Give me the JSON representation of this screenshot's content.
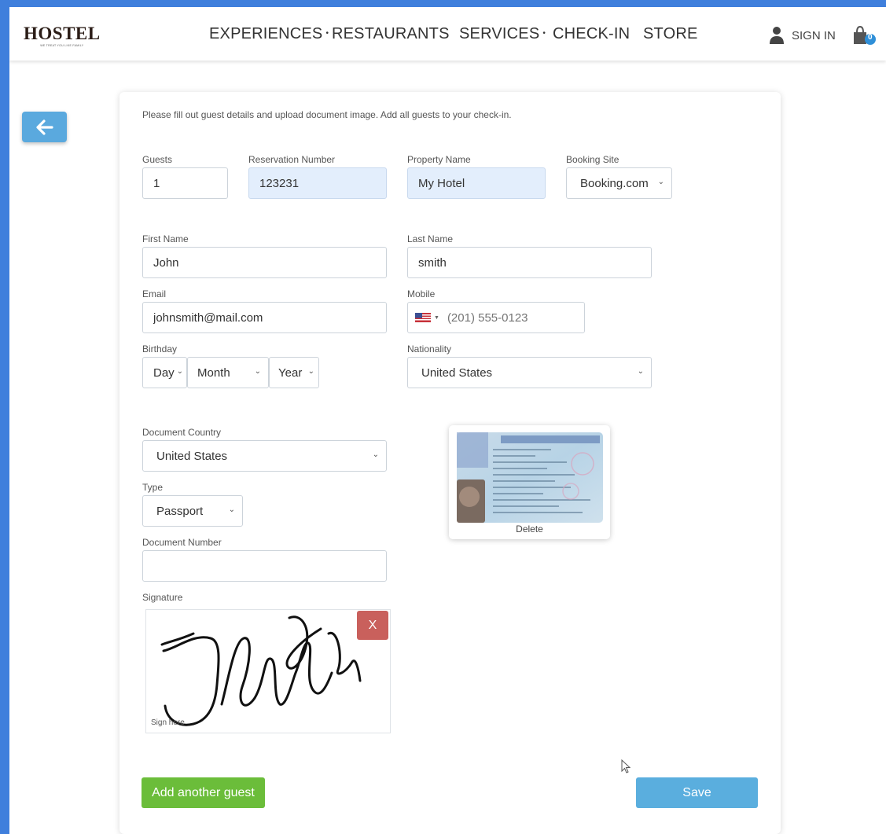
{
  "header": {
    "logo": "HOSTEL",
    "logo_tagline": "WE TREAT YOU LIKE FAMILY",
    "nav": [
      {
        "label": "EXPERIENCES",
        "has_caret": true
      },
      {
        "label": "RESTAURANTS",
        "has_caret": false
      },
      {
        "label": "SERVICES",
        "has_caret": true
      },
      {
        "label": "CHECK-IN",
        "has_caret": false
      },
      {
        "label": "STORE",
        "has_caret": false
      }
    ],
    "sign_in": "SIGN IN",
    "cart_count": "0"
  },
  "form": {
    "intro": "Please fill out guest details and upload document image. Add all guests to your check-in.",
    "guests": {
      "label": "Guests",
      "value": "1"
    },
    "reservation": {
      "label": "Reservation Number",
      "value": "123231"
    },
    "property": {
      "label": "Property Name",
      "value": "My Hotel"
    },
    "booking_site": {
      "label": "Booking Site",
      "value": "Booking.com"
    },
    "first_name": {
      "label": "First Name",
      "value": "John"
    },
    "last_name": {
      "label": "Last Name",
      "value": "smith"
    },
    "email": {
      "label": "Email",
      "value": "johnsmith@mail.com"
    },
    "mobile": {
      "label": "Mobile",
      "placeholder": "(201) 555-0123",
      "flag": "us-flag-icon"
    },
    "birthday": {
      "label": "Birthday",
      "day": "Day",
      "month": "Month",
      "year": "Year"
    },
    "nationality": {
      "label": "Nationality",
      "value": "United States"
    },
    "document_country": {
      "label": "Document Country",
      "value": "United States"
    },
    "type": {
      "label": "Type",
      "value": "Passport"
    },
    "document_number": {
      "label": "Document Number",
      "value": ""
    },
    "document_image": {
      "delete_label": "Delete"
    },
    "signature": {
      "label": "Signature",
      "clear_label": "X",
      "hint": "Sign here"
    },
    "add_guest_label": "Add another guest",
    "save_label": "Save"
  },
  "colors": {
    "page_frame": "#3f7fdc",
    "accent_blue": "#5aaede",
    "add_green": "#6bbd3a",
    "clear_red": "#c9605c",
    "prefilled_field": "#e3eefc"
  }
}
